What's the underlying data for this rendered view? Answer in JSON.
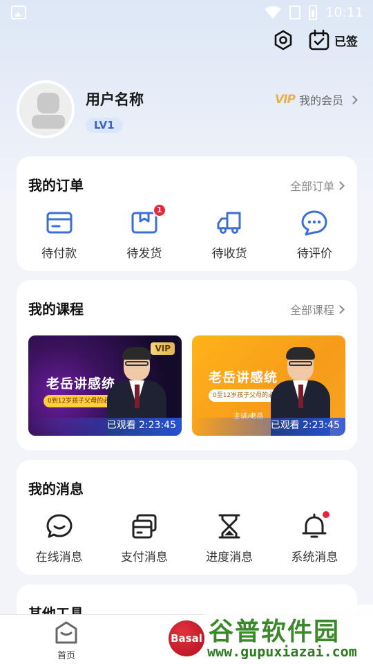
{
  "status_bar": {
    "time": "10:11"
  },
  "header": {
    "signed_label": "已签"
  },
  "profile": {
    "username": "用户名称",
    "level": "LV1",
    "vip_mark": "VIP",
    "member_label": "我的会员"
  },
  "orders": {
    "title": "我的订单",
    "more_label": "全部订单",
    "items": [
      {
        "label": "待付款",
        "icon": "wallet-card-icon"
      },
      {
        "label": "待发货",
        "icon": "package-icon",
        "badge": "1"
      },
      {
        "label": "待收货",
        "icon": "truck-icon"
      },
      {
        "label": "待评价",
        "icon": "chat-bubble-icon"
      }
    ]
  },
  "courses": {
    "title": "我的课程",
    "more_label": "全部课程",
    "items": [
      {
        "title": "老岳讲感统",
        "subtitle": "0到12岁孩子父母的必修课",
        "vip": "VIP",
        "watched": "已观看 2:23:45"
      },
      {
        "title": "老岳讲感统",
        "subtitle": "0至12岁孩子父母的必修课",
        "author": "主讲/老岳",
        "watched": "已观看 2:23:45"
      }
    ]
  },
  "messages": {
    "title": "我的消息",
    "items": [
      {
        "label": "在线消息",
        "icon": "chat-icon"
      },
      {
        "label": "支付消息",
        "icon": "cards-icon"
      },
      {
        "label": "进度消息",
        "icon": "hourglass-icon"
      },
      {
        "label": "系统消息",
        "icon": "bell-icon",
        "dot": true
      }
    ]
  },
  "tools": {
    "title": "其他工具"
  },
  "tabbar": {
    "home_label": "首页"
  },
  "overlay": {
    "basal_logo": "Basal",
    "watermark_top": "谷普软件园",
    "watermark_bottom": "www.gupuxiazai.com"
  },
  "colors": {
    "accent": "#3a6fd8",
    "badge": "#e8263a",
    "vip_gold": "#e3b34b"
  }
}
